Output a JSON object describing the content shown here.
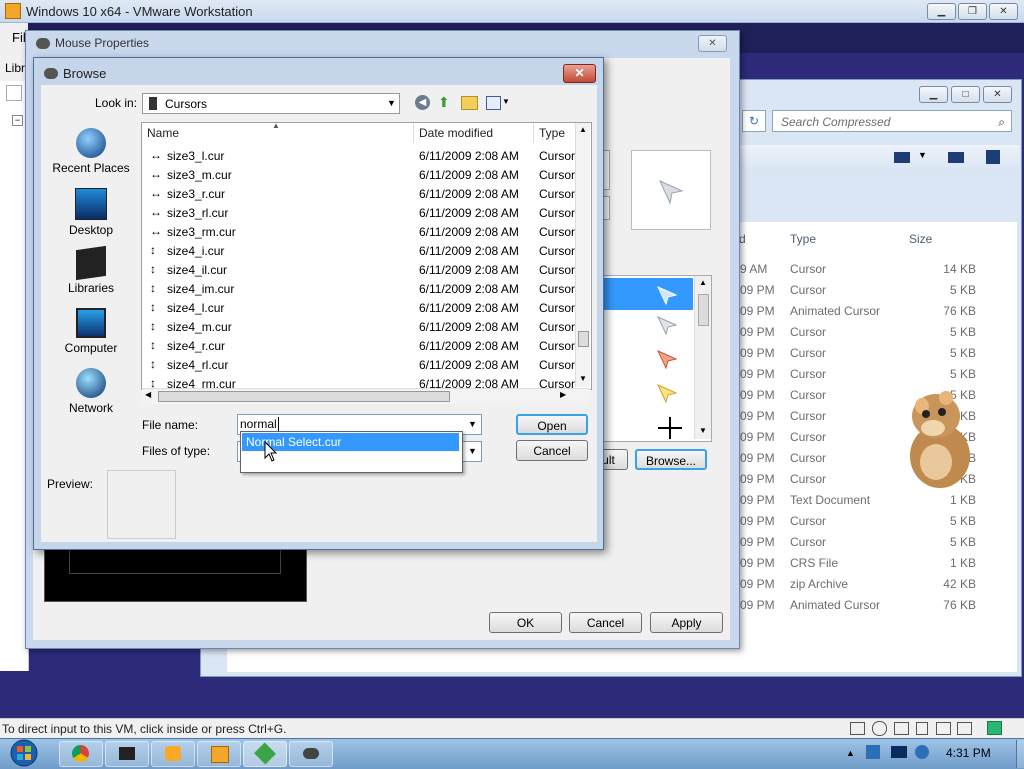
{
  "vmware": {
    "title": "Windows 10 x64 - VMware Workstation",
    "menu_label": "Fil",
    "lib_label": "Libr",
    "status_text": "To direct input to this VM, click inside or press Ctrl+G."
  },
  "explorer": {
    "search_placeholder": "Search Compressed",
    "columns": {
      "date_fragment": "d",
      "type": "Type",
      "size": "Size"
    },
    "rows": [
      {
        "date": "9 AM",
        "type": "Cursor",
        "size": "14 KB"
      },
      {
        "date": "09 PM",
        "type": "Cursor",
        "size": "5 KB"
      },
      {
        "date": "09 PM",
        "type": "Animated Cursor",
        "size": "76 KB"
      },
      {
        "date": "09 PM",
        "type": "Cursor",
        "size": "5 KB"
      },
      {
        "date": "09 PM",
        "type": "Cursor",
        "size": "5 KB"
      },
      {
        "date": "09 PM",
        "type": "Cursor",
        "size": "5 KB"
      },
      {
        "date": "09 PM",
        "type": "Cursor",
        "size": "5 KB"
      },
      {
        "date": "09 PM",
        "type": "Cursor",
        "size": "KB"
      },
      {
        "date": "09 PM",
        "type": "Cursor",
        "size": "KB"
      },
      {
        "date": "09 PM",
        "type": "Cursor",
        "size": "KB"
      },
      {
        "date": "09 PM",
        "type": "Cursor",
        "size": "KB"
      },
      {
        "date": "09 PM",
        "type": "Text Document",
        "size": "1 KB"
      },
      {
        "date": "09 PM",
        "type": "Cursor",
        "size": "5 KB"
      },
      {
        "date": "09 PM",
        "type": "Cursor",
        "size": "5 KB"
      },
      {
        "date": "09 PM",
        "type": "CRS File",
        "size": "1 KB"
      },
      {
        "date": "09 PM",
        "type": "zip Archive",
        "size": "42 KB"
      },
      {
        "date": "09 PM",
        "type": "Animated Cursor",
        "size": "76 KB"
      }
    ]
  },
  "mouse_props": {
    "title": "Mouse Properties",
    "browse_label": "Browse...",
    "default_fragment": "ult",
    "ok": "OK",
    "cancel": "Cancel",
    "apply": "Apply"
  },
  "browse": {
    "title": "Browse",
    "look_in_label": "Look in:",
    "look_in_value": "Cursors",
    "places": [
      "Recent Places",
      "Desktop",
      "Libraries",
      "Computer",
      "Network"
    ],
    "columns": {
      "name": "Name",
      "date": "Date modified",
      "type": "Type"
    },
    "files": [
      {
        "icon": "↔",
        "name": "size3_l.cur",
        "date": "6/11/2009 2:08 AM",
        "type": "Cursor"
      },
      {
        "icon": "↔",
        "name": "size3_m.cur",
        "date": "6/11/2009 2:08 AM",
        "type": "Cursor"
      },
      {
        "icon": "↔",
        "name": "size3_r.cur",
        "date": "6/11/2009 2:08 AM",
        "type": "Cursor"
      },
      {
        "icon": "↔",
        "name": "size3_rl.cur",
        "date": "6/11/2009 2:08 AM",
        "type": "Cursor"
      },
      {
        "icon": "↔",
        "name": "size3_rm.cur",
        "date": "6/11/2009 2:08 AM",
        "type": "Cursor"
      },
      {
        "icon": "↕",
        "name": "size4_i.cur",
        "date": "6/11/2009 2:08 AM",
        "type": "Cursor"
      },
      {
        "icon": "↕",
        "name": "size4_il.cur",
        "date": "6/11/2009 2:08 AM",
        "type": "Cursor"
      },
      {
        "icon": "↕",
        "name": "size4_im.cur",
        "date": "6/11/2009 2:08 AM",
        "type": "Cursor"
      },
      {
        "icon": "↕",
        "name": "size4_l.cur",
        "date": "6/11/2009 2:08 AM",
        "type": "Cursor"
      },
      {
        "icon": "↕",
        "name": "size4_m.cur",
        "date": "6/11/2009 2:08 AM",
        "type": "Cursor"
      },
      {
        "icon": "↕",
        "name": "size4_r.cur",
        "date": "6/11/2009 2:08 AM",
        "type": "Cursor"
      },
      {
        "icon": "↕",
        "name": "size4_rl.cur",
        "date": "6/11/2009 2:08 AM",
        "type": "Cursor"
      },
      {
        "icon": "↕",
        "name": "size4_rm.cur",
        "date": "6/11/2009 2:08 AM",
        "type": "Cursor"
      }
    ],
    "file_name_label": "File name:",
    "file_name_value": "normal",
    "files_of_type_label": "Files of type:",
    "autocomplete_item": "Normal Select.cur",
    "preview_label": "Preview:",
    "open": "Open",
    "cancel": "Cancel"
  },
  "taskbar": {
    "clock": "4:31 PM"
  }
}
